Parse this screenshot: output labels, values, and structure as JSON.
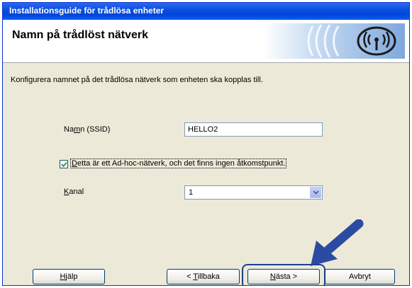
{
  "window": {
    "title": "Installationsguide för trådlösa enheter"
  },
  "header": {
    "heading": "Namn på trådlöst nätverk",
    "logo_icon": "wireless-signal-icon"
  },
  "instruction": "Konfigurera namnet på det trådlösa nätverk som enheten ska kopplas till.",
  "form": {
    "ssid": {
      "label_pre": "Na",
      "label_key": "m",
      "label_post": "n (SSID)",
      "value": "HELLO2"
    },
    "adhoc": {
      "checked": true,
      "label_key": "D",
      "label_post": "etta är ett Ad-hoc-nätverk, och det finns ingen åtkomstpunkt."
    },
    "channel": {
      "label_key": "K",
      "label_post": "anal",
      "value": "1"
    }
  },
  "buttons": {
    "help": {
      "key": "H",
      "rest": "jälp"
    },
    "back": {
      "pre": "< ",
      "key": "T",
      "rest": "illbaka"
    },
    "next": {
      "key": "N",
      "rest": "ästa >"
    },
    "cancel": "Avbryt"
  },
  "colors": {
    "title_bar": "#0a4fe0",
    "highlight": "#1f3f94",
    "dialog_bg": "#ece9d8"
  }
}
